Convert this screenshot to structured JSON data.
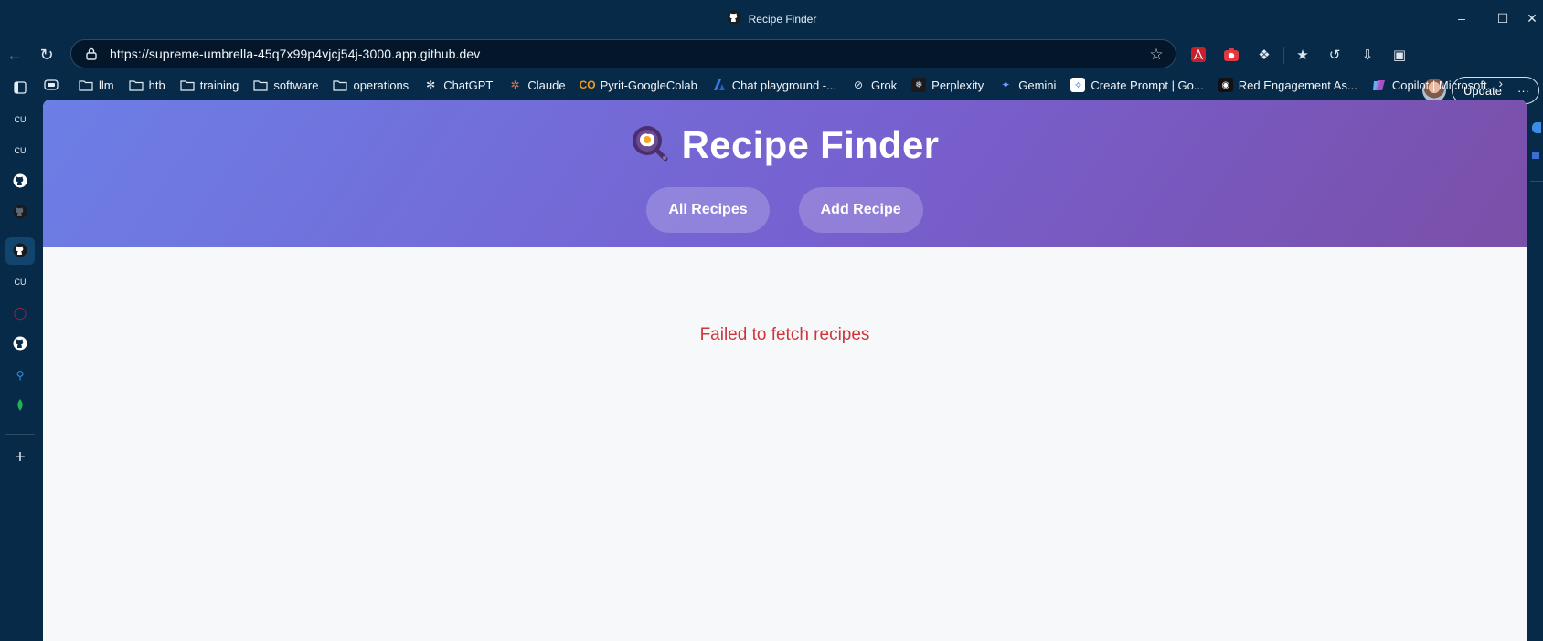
{
  "window": {
    "title": "Recipe Finder",
    "title_icon": "github-icon"
  },
  "address_bar": {
    "url": "https://supreme-umbrella-45q7x99p4vjcj54j-3000.app.github.dev"
  },
  "toolbar": {
    "update_label": "Update",
    "more_label": "···"
  },
  "bookmarks": [
    {
      "label": "",
      "icon": "media-icon"
    },
    {
      "label": "llm",
      "icon": "folder-icon"
    },
    {
      "label": "htb",
      "icon": "folder-icon"
    },
    {
      "label": "training",
      "icon": "folder-icon"
    },
    {
      "label": "software",
      "icon": "folder-icon"
    },
    {
      "label": "operations",
      "icon": "folder-icon"
    },
    {
      "label": "ChatGPT",
      "icon": "chatgpt-icon"
    },
    {
      "label": "Claude",
      "icon": "claude-icon"
    },
    {
      "label": "Pyrit-GoogleColab",
      "icon": "colab-icon"
    },
    {
      "label": "Chat playground -...",
      "icon": "azure-icon"
    },
    {
      "label": "Grok",
      "icon": "grok-icon"
    },
    {
      "label": "Perplexity",
      "icon": "perplexity-icon"
    },
    {
      "label": "Gemini",
      "icon": "gemini-icon"
    },
    {
      "label": "Create Prompt | Go...",
      "icon": "prompt-icon"
    },
    {
      "label": "Red Engagement As...",
      "icon": "red-engagement-icon"
    },
    {
      "label": "Copilot | Microsoft...",
      "icon": "copilot-icon"
    }
  ],
  "sidebar_items": [
    {
      "label": "",
      "icon": "tabs-icon"
    },
    {
      "label": "CU",
      "icon": "cu-icon"
    },
    {
      "label": "CU",
      "icon": "cu-icon"
    },
    {
      "label": "",
      "icon": "github-icon"
    },
    {
      "label": "",
      "icon": "github-icon"
    },
    {
      "label": "",
      "icon": "github-icon"
    },
    {
      "label": "CU",
      "icon": "cu-icon"
    },
    {
      "label": "",
      "icon": "red-circle-icon"
    },
    {
      "label": "",
      "icon": "github-icon"
    },
    {
      "label": "",
      "icon": "search-icon"
    },
    {
      "label": "",
      "icon": "mongodb-leaf-icon"
    },
    {
      "label": "",
      "icon": "plus-icon"
    }
  ],
  "app": {
    "title": "Recipe Finder",
    "logo_icon": "frying-pan-egg-icon",
    "nav": [
      {
        "label": "All Recipes"
      },
      {
        "label": "Add Recipe"
      }
    ],
    "error_message": "Failed to fetch recipes"
  },
  "colors": {
    "browser_bg": "#072a48",
    "hero_gradient_start": "#6c7fe6",
    "hero_gradient_end": "#7a4fa8",
    "error_text": "#d0353b",
    "page_bg": "#f7f8fa"
  }
}
